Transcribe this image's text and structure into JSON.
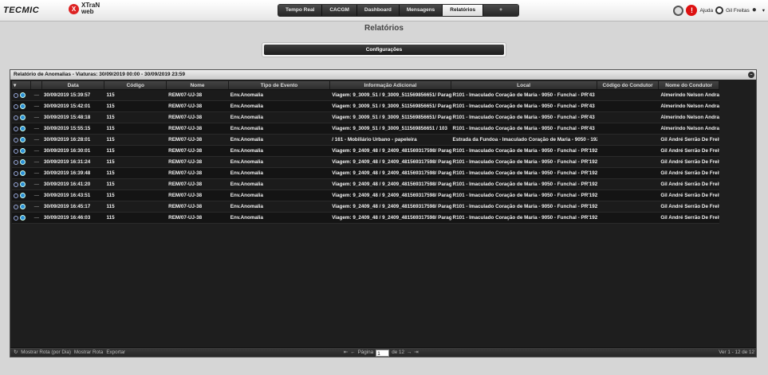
{
  "header": {
    "logo_text": "TECMIC",
    "logo2_letter": "X",
    "logo2_line1": "XTraN",
    "logo2_line2": "web",
    "nav": [
      "Tempo Real",
      "CACGM",
      "Dashboard",
      "Mensagens",
      "Relatórios",
      "+"
    ],
    "active_nav": "Relatórios",
    "help_label": "Ajuda",
    "user_name": "Gil Freitas",
    "alert_symbol": "!"
  },
  "page": {
    "title": "Relatórios",
    "config_button": "Configurações"
  },
  "report": {
    "title": "Relatório de Anomalias - Viaturas: 30/09/2019 00:00 - 30/09/2019 23:59",
    "columns": [
      "Data",
      "Código",
      "Nome",
      "Tipo de Evento",
      "Informação Adicional",
      "Local",
      "Código do Condutor",
      "Nome do Condutor"
    ],
    "rows": [
      [
        "30/09/2019 15:39:57",
        "115",
        "REM/07-UJ-38",
        "Env.Anomalia",
        "Viagem: 9_3009_51 / 9_3009_511569856651/ Parag",
        "R101 - Imaculado Coração de Maria - 9050 - Funchal - PR'43",
        "",
        "Almerindo Nelson Andra"
      ],
      [
        "30/09/2019 15:42:01",
        "115",
        "REM/07-UJ-38",
        "Env.Anomalia",
        "Viagem: 9_3009_51 / 9_3009_511569856651/ Parag",
        "R101 - Imaculado Coração de Maria - 9050 - Funchal - PR'43",
        "",
        "Almerindo Nelson Andra"
      ],
      [
        "30/09/2019 15:48:18",
        "115",
        "REM/07-UJ-38",
        "Env.Anomalia",
        "Viagem: 9_3009_51 / 9_3009_511569856651/ Parag",
        "R101 - Imaculado Coração de Maria - 9050 - Funchal - PR'43",
        "",
        "Almerindo Nelson Andra"
      ],
      [
        "30/09/2019 15:55:15",
        "115",
        "REM/07-UJ-38",
        "Env.Anomalia",
        "Viagem: 9_3009_51 / 9_3009_511569856651 / 103",
        "R101 - Imaculado Coração de Maria - 9050 - Funchal - PR'43",
        "",
        "Almerindo Nelson Andra"
      ],
      [
        "30/09/2019 16:28:01",
        "115",
        "REM/07-UJ-38",
        "Env.Anomalia",
        "/ 161 - Mobiliário Urbano - papeleira",
        "Estrada da Fundoa - Imaculado Coração de Maria - 9050 - 192",
        "",
        "Gil André Serrão De Freit"
      ],
      [
        "30/09/2019 16:30:01",
        "115",
        "REM/07-UJ-38",
        "Env.Anomalia",
        "Viagem: 9_2409_48 / 9_2409_481569317598/ Parag",
        "R101 - Imaculado Coração de Maria - 9050 - Funchal - PR'192",
        "",
        "Gil André Serrão De Freit"
      ],
      [
        "30/09/2019 16:31:24",
        "115",
        "REM/07-UJ-38",
        "Env.Anomalia",
        "Viagem: 9_2409_48 / 9_2409_481569317598/ Parag",
        "R101 - Imaculado Coração de Maria - 9050 - Funchal - PR'192",
        "",
        "Gil André Serrão De Freit"
      ],
      [
        "30/09/2019 16:39:48",
        "115",
        "REM/07-UJ-38",
        "Env.Anomalia",
        "Viagem: 9_2409_48 / 9_2409_481569317598/ Parag",
        "R101 - Imaculado Coração de Maria - 9050 - Funchal - PR'192",
        "",
        "Gil André Serrão De Freit"
      ],
      [
        "30/09/2019 16:41:20",
        "115",
        "REM/07-UJ-38",
        "Env.Anomalia",
        "Viagem: 9_2409_48 / 9_2409_481569317598/ Parag",
        "R101 - Imaculado Coração de Maria - 9050 - Funchal - PR'192",
        "",
        "Gil André Serrão De Freit"
      ],
      [
        "30/09/2019 16:43:51",
        "115",
        "REM/07-UJ-38",
        "Env.Anomalia",
        "Viagem: 9_2409_48 / 9_2409_481569317598/ Parag",
        "R101 - Imaculado Coração de Maria - 9050 - Funchal - PR'192",
        "",
        "Gil André Serrão De Freit"
      ],
      [
        "30/09/2019 16:45:17",
        "115",
        "REM/07-UJ-38",
        "Env.Anomalia",
        "Viagem: 9_2409_48 / 9_2409_481569317598/ Parag",
        "R101 - Imaculado Coração de Maria - 9050 - Funchal - PR'192",
        "",
        "Gil André Serrão De Freit"
      ],
      [
        "30/09/2019 16:46:03",
        "115",
        "REM/07-UJ-38",
        "Env.Anomalia",
        "Viagem: 9_2409_48 / 9_2409_481569317598/ Parag",
        "R101 - Imaculado Coração de Maria - 9050 - Funchal - PR'192",
        "",
        "Gil André Serrão De Freit"
      ]
    ]
  },
  "footer": {
    "show_route_day": "Mostrar Rota (por Dia)",
    "show_route": "Mostrar Rota",
    "export": "Exportar",
    "page_label": "Página",
    "page_value": "1",
    "page_of": "de 12",
    "view_summary": "Ver 1 - 12 de 12"
  }
}
